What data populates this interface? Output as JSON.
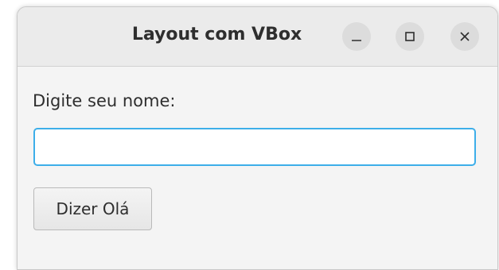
{
  "window": {
    "title": "Layout com VBox",
    "controls": {
      "minimize": "minimize-icon",
      "maximize": "maximize-icon",
      "close": "close-icon"
    }
  },
  "form": {
    "prompt_label": "Digite seu nome:",
    "name_value": "",
    "name_placeholder": "",
    "submit_label": "Dizer Olá"
  },
  "colors": {
    "focus_border": "#3daee9",
    "titlebar_bg": "#ebebeb",
    "content_bg": "#f4f4f4"
  }
}
